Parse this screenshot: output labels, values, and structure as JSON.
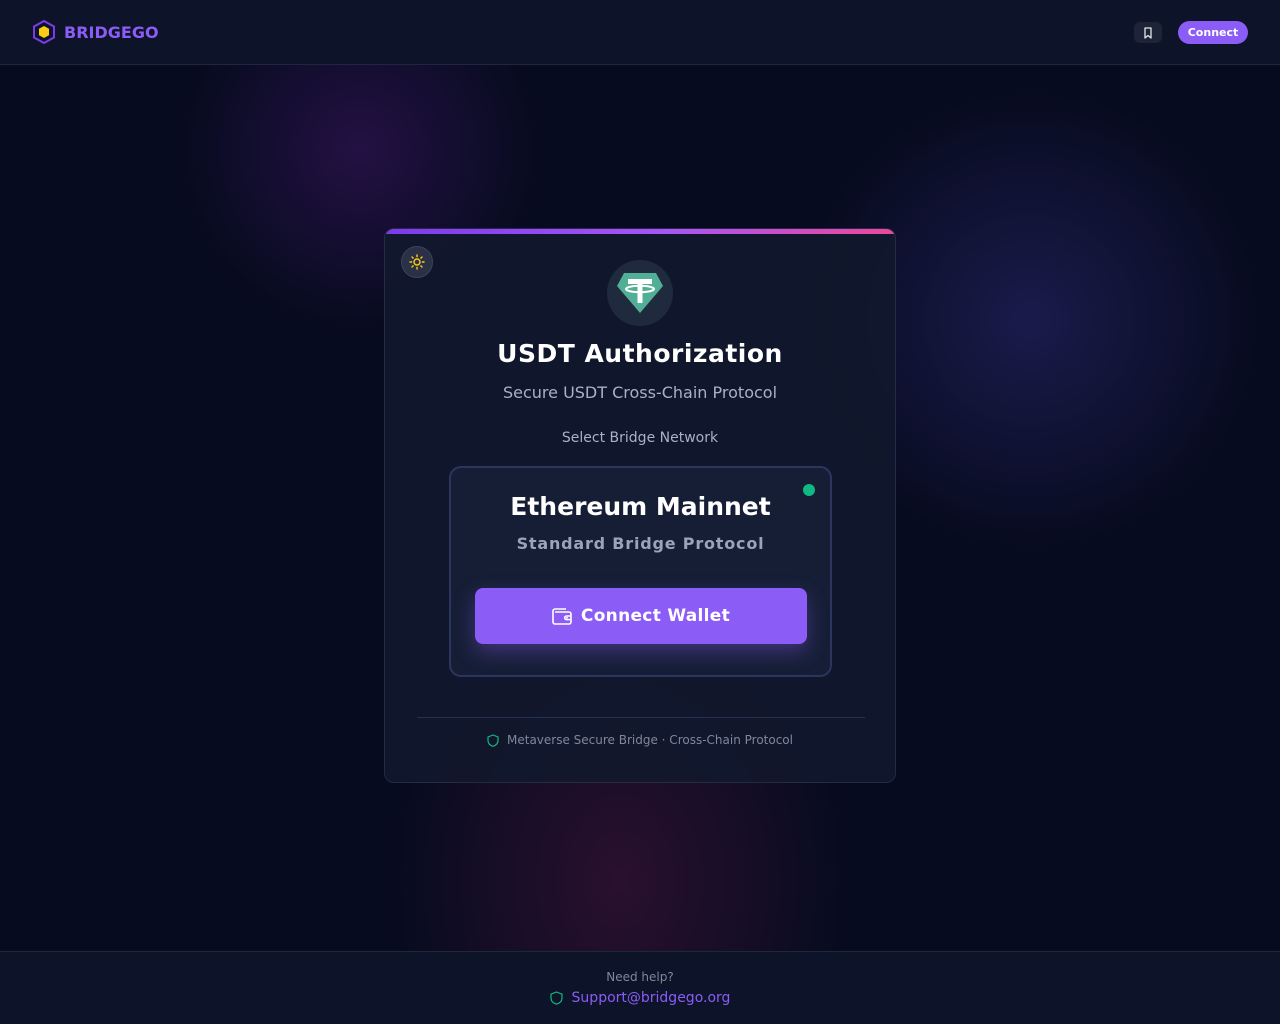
{
  "header": {
    "brand": "BRIDGEGO",
    "connect_label": "Connect"
  },
  "card": {
    "title": "USDT Authorization",
    "subtitle": "Secure USDT Cross-Chain Protocol",
    "select_label": "Select Bridge Network",
    "network": {
      "name": "Ethereum Mainnet",
      "protocol": "Standard Bridge Protocol",
      "status": "active"
    },
    "connect_wallet_label": "Connect Wallet",
    "footer_note": "Metaverse Secure Bridge · Cross-Chain Protocol"
  },
  "footer": {
    "help_text": "Need help?",
    "support_email": "Support@bridgego.org"
  },
  "icons": {
    "brand": "hexagon-logo-icon",
    "bookmark": "bookmark-icon",
    "theme": "sun-icon",
    "token": "tether-usdt-icon",
    "wallet": "wallet-icon",
    "shield": "shield-icon"
  },
  "colors": {
    "accent": "#8b5cf6",
    "status_online": "#10b981",
    "tether": "#50af95",
    "sun": "#facc15"
  }
}
